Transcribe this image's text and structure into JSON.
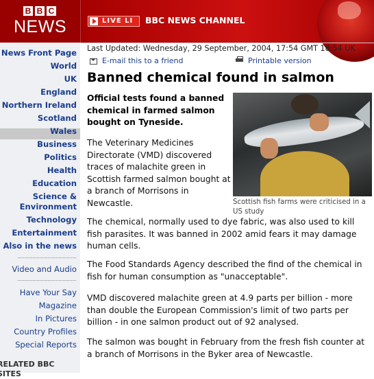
{
  "header": {
    "logo_bbc": [
      "B",
      "B",
      "C"
    ],
    "logo_news": "NEWS",
    "live_label": "LIVE LI",
    "channel_label": "BBC NEWS CHANNEL"
  },
  "sidebar": {
    "items": [
      {
        "label": "News Front Page"
      },
      {
        "label": "World"
      },
      {
        "label": "UK"
      },
      {
        "label": "England"
      },
      {
        "label": "Northern Ireland"
      },
      {
        "label": "Scotland"
      },
      {
        "label": "Wales"
      },
      {
        "label": "Business"
      },
      {
        "label": "Politics"
      },
      {
        "label": "Health"
      },
      {
        "label": "Education"
      },
      {
        "label": "Science & Environment"
      },
      {
        "label": "Technology"
      },
      {
        "label": "Entertainment"
      },
      {
        "label": "Also in the news"
      }
    ],
    "secondary": [
      {
        "label": "Video and Audio"
      }
    ],
    "tertiary": [
      {
        "label": "Have Your Say"
      },
      {
        "label": "Magazine"
      },
      {
        "label": "In Pictures"
      },
      {
        "label": "Country Profiles"
      },
      {
        "label": "Special Reports"
      }
    ],
    "related": "RELATED BBC SITES",
    "selected": "England"
  },
  "article": {
    "updated": "Last Updated: Wednesday, 29 September, 2004, 17:54 GMT 18:54 UK",
    "email_link": "E-mail this to a friend",
    "print_link": "Printable version",
    "headline": "Banned chemical found in salmon",
    "intro": "Official tests found a banned chemical in farmed salmon bought on Tyneside.",
    "p1": "The Veterinary Medicines Directorate (VMD) discovered traces of malachite green in Scottish farmed salmon bought at a branch of Morrisons in Newcastle.",
    "p2": "The chemical, normally used to dye fabric, was also used to kill fish parasites. It was banned in 2002 amid fears it may damage human cells.",
    "p3": "The Food Standards Agency described the find of the chemical in fish for human consumption as \"unacceptable\".",
    "p4": "VMD discovered malachite green at 4.9 parts per billion - more than double the European Commission's limit of two parts per billion - in one salmon product out of 92 analysed.",
    "p5": "The salmon was bought in February from the fresh fish counter at a branch of Morrisons in the Byker area of Newcastle.",
    "caption": "Scottish fish farms were criticised in a US study"
  },
  "colors": {
    "brand_red": "#990000",
    "link_blue": "#1a3d8c",
    "sidebar_bg": "#eef0f3"
  }
}
